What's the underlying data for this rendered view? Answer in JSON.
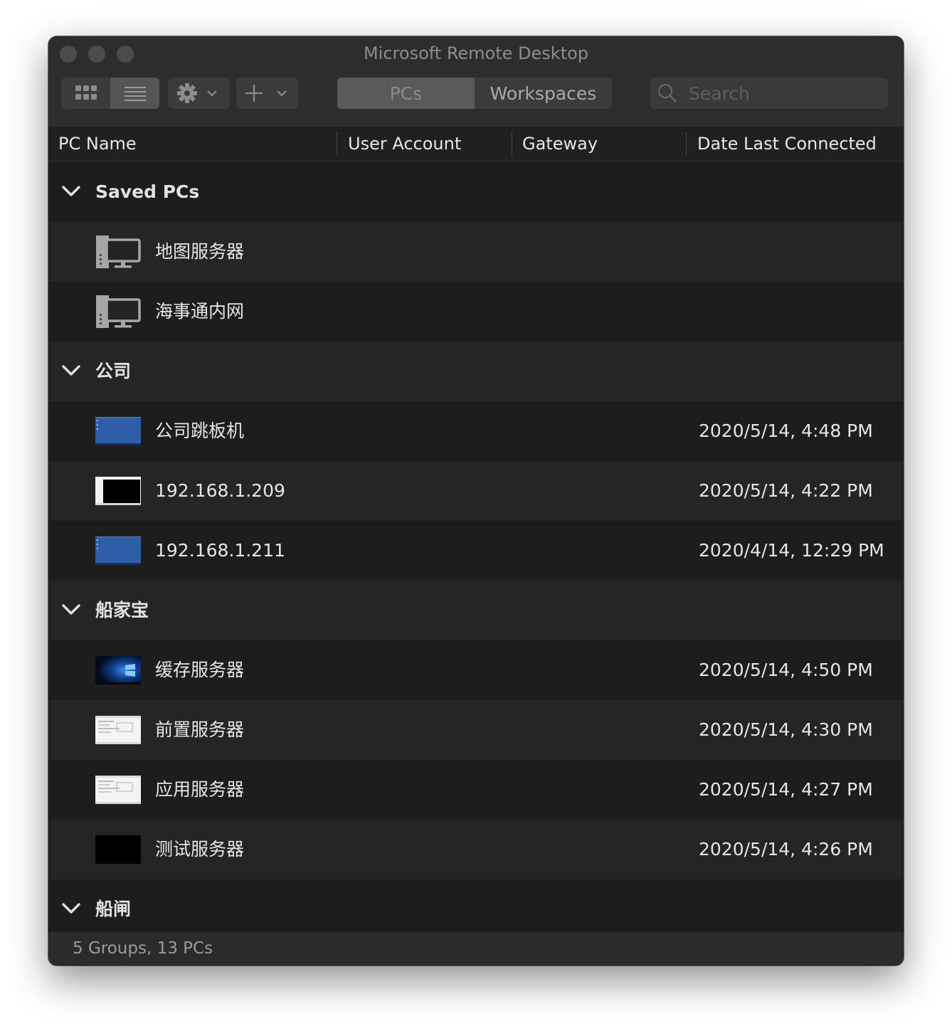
{
  "window": {
    "title": "Microsoft Remote Desktop"
  },
  "toolbar": {
    "tabs": [
      {
        "label": "PCs",
        "selected": true
      },
      {
        "label": "Workspaces",
        "selected": false
      }
    ],
    "search_placeholder": "Search"
  },
  "columns": [
    "PC Name",
    "User Account",
    "Gateway",
    "Date Last Connected"
  ],
  "groups": [
    {
      "name": "Saved PCs",
      "pcs": [
        {
          "name": "地图服务器",
          "date": "",
          "thumbnail": "generic-pc-icon"
        },
        {
          "name": "海事通内网",
          "date": "",
          "thumbnail": "generic-pc-icon"
        }
      ]
    },
    {
      "name": "公司",
      "pcs": [
        {
          "name": "公司跳板机",
          "date": "2020/5/14, 4:48 PM",
          "thumbnail": "blue-desktop"
        },
        {
          "name": "192.168.1.209",
          "date": "2020/5/14, 4:22 PM",
          "thumbnail": "black-window"
        },
        {
          "name": "192.168.1.211",
          "date": "2020/4/14, 12:29 PM",
          "thumbnail": "blue-desktop"
        }
      ]
    },
    {
      "name": "船家宝",
      "pcs": [
        {
          "name": "缓存服务器",
          "date": "2020/5/14, 4:50 PM",
          "thumbnail": "windows10-desktop"
        },
        {
          "name": "前置服务器",
          "date": "2020/5/14, 4:30 PM",
          "thumbnail": "white-app-window"
        },
        {
          "name": "应用服务器",
          "date": "2020/5/14, 4:27 PM",
          "thumbnail": "white-app-window"
        },
        {
          "name": "测试服务器",
          "date": "2020/5/14, 4:26 PM",
          "thumbnail": "black-screen"
        }
      ]
    },
    {
      "name": "船闸",
      "pcs": []
    }
  ],
  "status": "5 Groups, 13 PCs"
}
